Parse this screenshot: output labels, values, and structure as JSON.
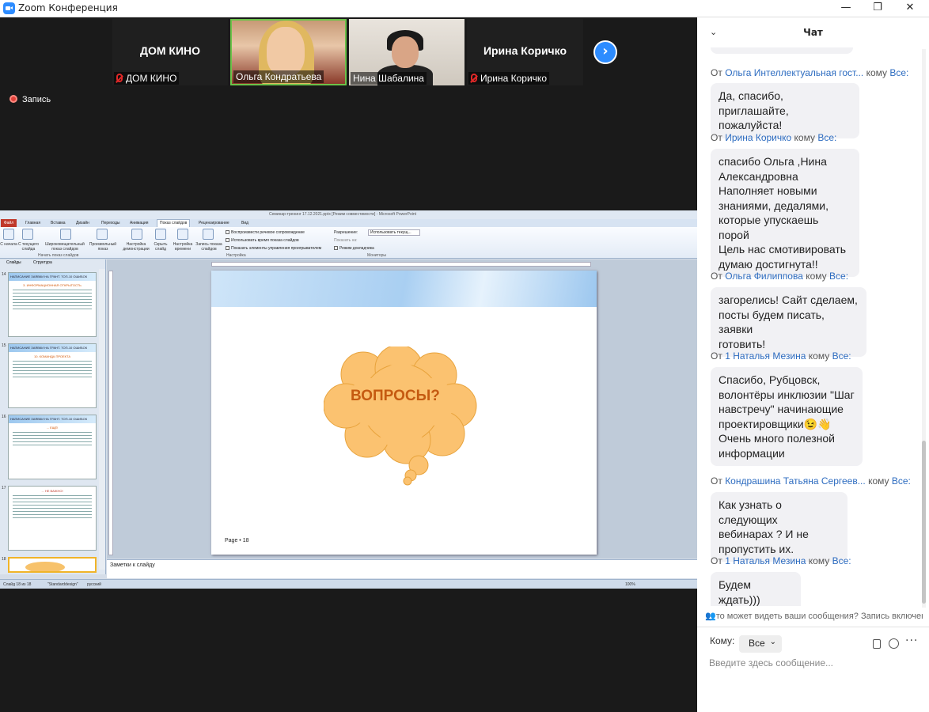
{
  "window": {
    "title": "Zoom Конференция",
    "controls": {
      "minimize": "—",
      "maximize": "❐",
      "close": "✕"
    }
  },
  "participants": [
    {
      "big_name": "ДОМ КИНО",
      "label": "ДОМ КИНО",
      "muted": true
    },
    {
      "big_name": "",
      "label": "Ольга Кондратьева",
      "muted": false,
      "active_speaker": true
    },
    {
      "big_name": "",
      "label": "Нина Шабалина",
      "muted": false
    },
    {
      "big_name": "Ирина Коричко",
      "label": "Ирина Коричко",
      "muted": true
    }
  ],
  "next_participants": "›",
  "recording": {
    "label": "Запись"
  },
  "powerpoint": {
    "title": "Семинар-тренинг 17.12.2021.pptx [Режим совместимости] - Microsoft PowerPoint",
    "tabs": [
      "Файл",
      "Главная",
      "Вставка",
      "Дизайн",
      "Переходы",
      "Анимация",
      "Показ слайдов",
      "Рецензирование",
      "Вид"
    ],
    "active_tab": "Показ слайдов",
    "ribbon": {
      "buttons": [
        "С начала",
        "С текущего слайда",
        "Широковещательный показ слайдов",
        "Произвольный показ",
        "Настройка демонстрации",
        "Скрыть слайд",
        "Настройка времени",
        "Запись показа слайдов"
      ],
      "checks": [
        "Воспроизвести речевое сопровождение",
        "Использовать время показа слайдов",
        "Показать элементы управления проигрывателем"
      ],
      "monitor": {
        "resolution_label": "Разрешение:",
        "resolution_value": "Использовать текущ...",
        "show_on": "Показать на:",
        "presenter": "Режим докладчика"
      },
      "groups": [
        "Начать показ слайдов",
        "Настройка",
        "Мониторы"
      ]
    },
    "left_tabs": [
      "Слайды",
      "Структура"
    ],
    "thumbnails": [
      {
        "num": "14",
        "header": "НАПИСАНИЕ ЗАЯВКИ НА ГРАНТ. ТОП-10 ОШИБОК",
        "sub": "3. ИНФОРМАЦИОННАЯ ОТКРЫТОСТЬ"
      },
      {
        "num": "15",
        "header": "НАПИСАНИЕ ЗАЯВКИ НА ГРАНТ. ТОП-10 ОШИБОК",
        "sub": "10. КОМАНДА ПРОЕКТА"
      },
      {
        "num": "16",
        "header": "НАПИСАНИЕ ЗАЯВКИ НА ГРАНТ. ТОП-10 ОШИБОК",
        "sub": "... ЕЩЁ!"
      },
      {
        "num": "17",
        "header": "",
        "sub": "... НЕ ВАЖНО!"
      },
      {
        "num": "18",
        "header": "",
        "sub": ""
      }
    ],
    "slide": {
      "heading": "ВОПРОСЫ?",
      "page": "Page • 18"
    },
    "notes_placeholder": "Заметки к слайду",
    "status": {
      "slide": "Слайд 18 из 18",
      "theme": "\"Standarddesign\"",
      "lang": "русский",
      "zoom": "100%"
    }
  },
  "chat": {
    "title": "Чат",
    "from_prefix": "От",
    "to_word": "кому",
    "messages": [
      {
        "from": "Ольга Интеллектуальная гост...",
        "to": "Все:",
        "lines": [
          "Да, спасибо, приглашайте,",
          "пожалуйста!"
        ]
      },
      {
        "from": "Ирина Коричко",
        "to": "Все:",
        "lines": [
          "спасибо Ольга ,Нина",
          "Александровна",
          "Наполняет новыми",
          "знаниями, дедалями,",
          "которые упускаешь порой",
          "Цель нас смотивировать",
          "думаю достигнута!!"
        ]
      },
      {
        "from": "Ольга Филиппова",
        "to": "Все:",
        "lines": [
          "загорелись! Сайт сделаем,",
          "посты будем писать, заявки",
          "готовить!"
        ]
      },
      {
        "from": "1 Наталья Мезина",
        "to": "Все:",
        "lines": [
          "Спасибо, Рубцовск,",
          "волонтёры инклюзии \"Шаг",
          "навстречу\" начинающие",
          "проектировщики😉👋",
          "Очень много полезной",
          "информации"
        ]
      },
      {
        "from": "Кондрашина Татьяна Сергеев...",
        "to": "Все:",
        "lines": [
          "Как узнать о следующих",
          "вебинарах ? И не",
          "пропустить их."
        ]
      },
      {
        "from": "1 Наталья Мезина",
        "to": "Все:",
        "lines": [
          "Будем ждать)))"
        ]
      }
    ],
    "notice": "то может видеть ваши сообщения? Запись включен",
    "to_label": "Кому:",
    "to_value": "Все",
    "input_placeholder": "Введите здесь сообщение..."
  }
}
